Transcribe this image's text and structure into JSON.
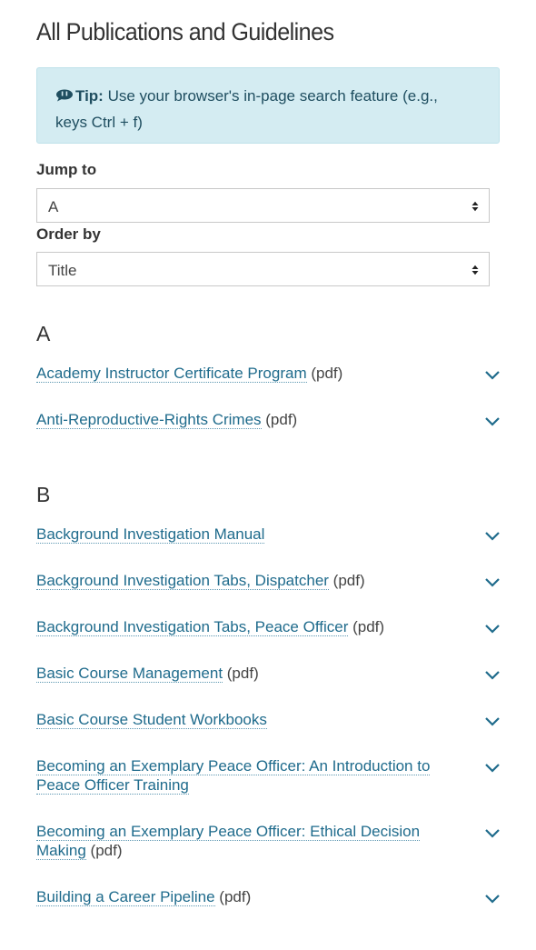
{
  "page": {
    "title": "All Publications and Guidelines"
  },
  "tip": {
    "label": "Tip:",
    "text": "Use your browser's in-page search feature (e.g., keys Ctrl + f)",
    "icon": "comment-icon"
  },
  "jump_to": {
    "label": "Jump to",
    "value": "A"
  },
  "order_by": {
    "label": "Order by",
    "value": "Title"
  },
  "colors": {
    "link": "#1f6b8c",
    "tip_bg": "#d4ecf2",
    "tip_text": "#1f4e60"
  },
  "sections": [
    {
      "letter": "A",
      "items": [
        {
          "title": "Academy Instructor Certificate Program",
          "suffix": " (pdf)"
        },
        {
          "title": "Anti-Reproductive-Rights Crimes",
          "suffix": " (pdf)"
        }
      ]
    },
    {
      "letter": "B",
      "items": [
        {
          "title": "Background Investigation Manual",
          "suffix": ""
        },
        {
          "title": "Background Investigation Tabs, Dispatcher",
          "suffix": " (pdf)"
        },
        {
          "title": "Background Investigation Tabs, Peace Officer",
          "suffix": " (pdf)"
        },
        {
          "title": "Basic Course Management",
          "suffix": " (pdf)"
        },
        {
          "title": "Basic Course Student Workbooks",
          "suffix": ""
        },
        {
          "title": "Becoming an Exemplary Peace Officer: An Introduction to Peace Officer Training",
          "suffix": ""
        },
        {
          "title": "Becoming an Exemplary Peace Officer: Ethical Decision Making",
          "suffix": " (pdf)"
        },
        {
          "title": "Building a Career Pipeline",
          "suffix": " (pdf)"
        }
      ]
    }
  ]
}
